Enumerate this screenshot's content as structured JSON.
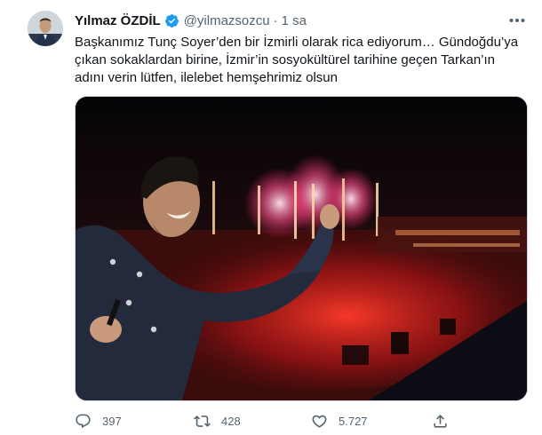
{
  "tweet": {
    "author": {
      "name": "Yılmaz ÖZDİL",
      "handle": "@yilmazsozcu",
      "verified": true,
      "avatar": "avatar-image"
    },
    "separator": "·",
    "timestamp": "1 sa",
    "more_icon": "more-horizontal-icon",
    "text_lines": [
      "Başkanımız Tunç Soyer’den bir İzmirli olarak rica ediyorum… Gündoğdu’ya",
      "çıkan sokaklardan birine, İzmir’in sosyokültürel tarihine geçen Tarkan’ın",
      "adını verin lütfen, ilelebet hemşehrimiz olsun"
    ],
    "media": {
      "icon": "photo-image"
    },
    "actions": {
      "reply": {
        "icon": "reply-icon",
        "count": "397"
      },
      "retweet": {
        "icon": "retweet-icon",
        "count": "428"
      },
      "like": {
        "icon": "like-icon",
        "count": "5.727"
      },
      "share": {
        "icon": "share-icon"
      }
    }
  },
  "colors": {
    "text": "#0f1419",
    "secondary": "#536471",
    "verified": "#1d9bf0",
    "border": "#cfd9de"
  }
}
